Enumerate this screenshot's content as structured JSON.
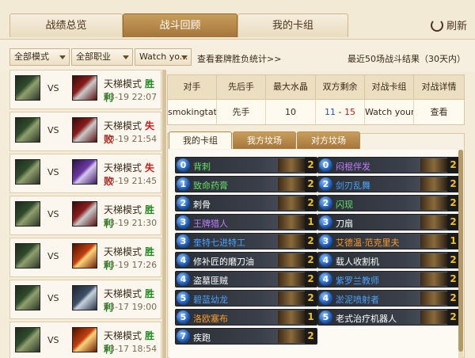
{
  "tabs": [
    {
      "label": "战绩总览"
    },
    {
      "label": "战斗回顾"
    },
    {
      "label": "我的卡组"
    }
  ],
  "refresh_label": "刷新",
  "filters": {
    "mode": "全部模式",
    "class": "全部职业",
    "deck": "Watch yo..."
  },
  "stat_link": "查看套牌胜负统计>>",
  "recent_label": "最近50场战斗结果（30天内）",
  "vs_label": "VS",
  "matches": [
    {
      "mode": "天梯模式",
      "result": "胜利",
      "date": "03-19 22:07",
      "outcome": "win",
      "opponent_icon": "warrior-hero-icon"
    },
    {
      "mode": "天梯模式",
      "result": "失败",
      "date": "03-19 21:54",
      "outcome": "lose",
      "opponent_icon": "warrior-hero-icon"
    },
    {
      "mode": "天梯模式",
      "result": "失败",
      "date": "03-19 21:45",
      "outcome": "lose",
      "opponent_icon": "mage-hero-icon"
    },
    {
      "mode": "天梯模式",
      "result": "胜利",
      "date": "03-19 21:30",
      "outcome": "win",
      "opponent_icon": "warrior-hero-icon"
    },
    {
      "mode": "天梯模式",
      "result": "胜利",
      "date": "03-19 17:26",
      "outcome": "win",
      "opponent_icon": "fire-hero-icon"
    },
    {
      "mode": "天梯模式",
      "result": "胜利",
      "date": "03-17 19:00",
      "outcome": "win",
      "opponent_icon": "steel-hero-icon"
    },
    {
      "mode": "天梯模式",
      "result": "胜利",
      "date": "03-17 18:54",
      "outcome": "win",
      "opponent_icon": "fire-hero-icon"
    }
  ],
  "detail": {
    "headers": [
      "对手",
      "先后手",
      "最大水晶",
      "双方剩余",
      "对战卡组",
      "对战详情"
    ],
    "opponent": "smokingtat...",
    "order": "先手",
    "max_crystal": "10",
    "remain_self": "11",
    "remain_sep": " - ",
    "remain_opp": "15",
    "deck": "Watch your...",
    "view": "查看"
  },
  "deck_tabs": [
    "我的卡组",
    "我方坟场",
    "对方坟场"
  ],
  "my_cards": [
    {
      "cost": "0",
      "name": "背刺",
      "count": "2",
      "quality": "basic"
    },
    {
      "cost": "1",
      "name": "致命药膏",
      "count": "2",
      "quality": "basic"
    },
    {
      "cost": "2",
      "name": "刺骨",
      "count": "2",
      "quality": "common"
    },
    {
      "cost": "3",
      "name": "王牌猎人",
      "count": "1",
      "quality": "epic"
    },
    {
      "cost": "3",
      "name": "奎特七进特工",
      "count": "2",
      "quality": "rare"
    },
    {
      "cost": "4",
      "name": "修补匠的磨刀油",
      "count": "2",
      "quality": "common"
    },
    {
      "cost": "4",
      "name": "盗墓匪贼",
      "count": "2",
      "quality": "common"
    },
    {
      "cost": "5",
      "name": "碧蓝幼龙",
      "count": "2",
      "quality": "rare"
    },
    {
      "cost": "5",
      "name": "洛欧塞布",
      "count": "1",
      "quality": "legend"
    },
    {
      "cost": "7",
      "name": "疾跑",
      "count": "2",
      "quality": "common"
    }
  ],
  "opp_cards": [
    {
      "cost": "0",
      "name": "闷棍伴发",
      "count": "2",
      "quality": "epic"
    },
    {
      "cost": "2",
      "name": "剑刃乱舞",
      "count": "2",
      "quality": "rare"
    },
    {
      "cost": "2",
      "name": "闪现",
      "count": "2",
      "quality": "basic"
    },
    {
      "cost": "3",
      "name": "刀扇",
      "count": "2",
      "quality": "common"
    },
    {
      "cost": "3",
      "name": "艾德温·范克里夫",
      "count": "1",
      "quality": "legend"
    },
    {
      "cost": "4",
      "name": "载人收割机",
      "count": "2",
      "quality": "common"
    },
    {
      "cost": "4",
      "name": "紫罗兰教师",
      "count": "2",
      "quality": "rare"
    },
    {
      "cost": "4",
      "name": "淤泥喷射者",
      "count": "2",
      "quality": "rare"
    },
    {
      "cost": "5",
      "name": "老式治疗机器人",
      "count": "2",
      "quality": "common"
    }
  ],
  "colors": {
    "win": "#1b8a1b",
    "lose": "#d01818",
    "active_tab": "#a5753a"
  }
}
